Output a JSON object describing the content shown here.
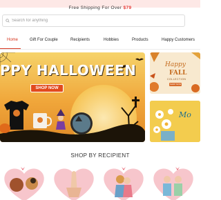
{
  "announcement": {
    "text": "Free Shipping For Over ",
    "price": "$79"
  },
  "search": {
    "placeholder": "Search for anything"
  },
  "nav": {
    "items": [
      {
        "label": "Home",
        "active": true
      },
      {
        "label": "Gift For Couple",
        "active": false
      },
      {
        "label": "Recipients",
        "active": false
      },
      {
        "label": "Hobbies",
        "active": false
      },
      {
        "label": "Products",
        "active": false
      },
      {
        "label": "Happy Customers",
        "active": false
      }
    ]
  },
  "hero": {
    "title": "PPY HALLOWEEN",
    "button": "SHOP NOW"
  },
  "side_banners": {
    "fall": {
      "line1": "Happy",
      "line2": "FALL",
      "line3": "COLLECTION",
      "button": "SHOP NOW"
    },
    "second": {
      "text": "Mo"
    }
  },
  "section": {
    "title": "SHOP BY RECIPIENT"
  },
  "colors": {
    "accent": "#d6341d",
    "topbar_bg": "#fde8e6",
    "price": "#e53935",
    "button": "#e24a1d"
  }
}
